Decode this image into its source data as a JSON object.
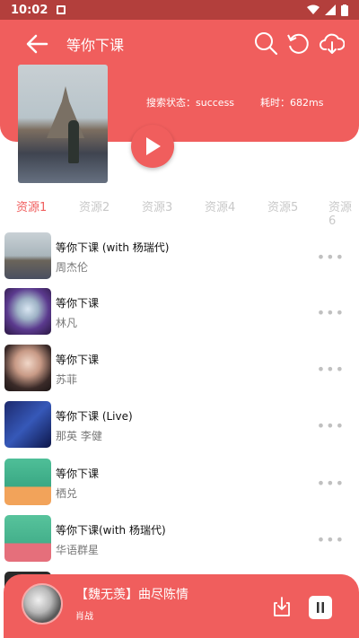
{
  "status_bar": {
    "time": "10:02"
  },
  "header": {
    "title": "等你下课",
    "search_status": "搜索状态：success",
    "elapsed": "耗时：682ms"
  },
  "tabs": [
    "资源1",
    "资源2",
    "资源3",
    "资源4",
    "资源5",
    "资源6"
  ],
  "songs": [
    {
      "title": "等你下课 (with 杨瑞代)",
      "artist": "周杰伦"
    },
    {
      "title": "等你下课",
      "artist": "林凡"
    },
    {
      "title": "等你下课",
      "artist": "苏菲"
    },
    {
      "title": "等你下课 (Live)",
      "artist": "那英  李健"
    },
    {
      "title": "等你下课",
      "artist": "栖兑"
    },
    {
      "title": "等你下课(with 杨瑞代)",
      "artist": "华语群星"
    }
  ],
  "more_glyph": "•••",
  "player": {
    "title": "【魏无羡】曲尽陈情",
    "artist": "肖战"
  },
  "colors": {
    "accent": "#f05e5d",
    "status_bar": "#b33f3c"
  }
}
